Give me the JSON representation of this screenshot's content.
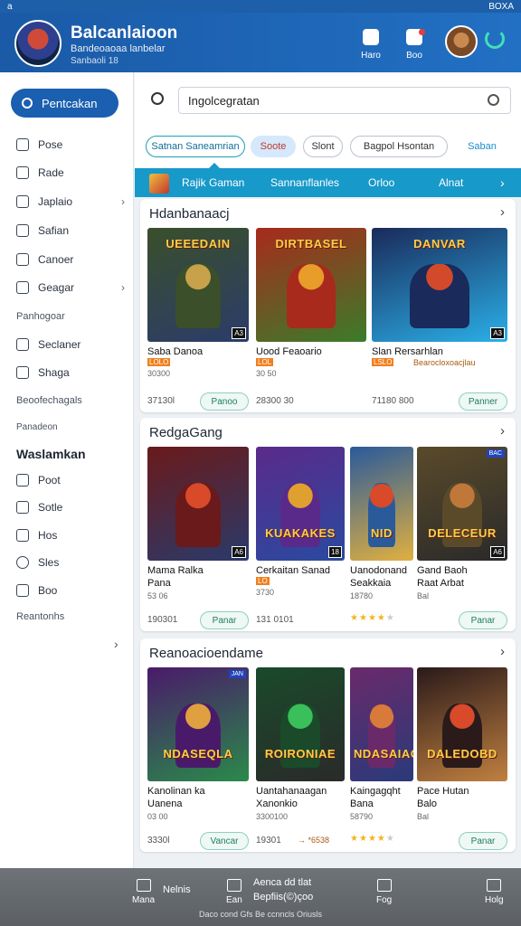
{
  "status": {
    "left": "a",
    "right": "BOXA"
  },
  "header": {
    "title": "Balcanlaioon",
    "subtitle": "Bandeoaoaa lanbelar",
    "subtitle2": "Sanbaoli 18",
    "buttons": [
      {
        "label": "Haro",
        "icon": "home-icon"
      },
      {
        "label": "Boo",
        "icon": "bell-icon"
      }
    ]
  },
  "sidebar": {
    "cta": "Pentcakan",
    "items": [
      {
        "label": "Pose",
        "icon": "pen-icon"
      },
      {
        "label": "Rade",
        "icon": "game-icon"
      },
      {
        "label": "Japlaio",
        "icon": "home-icon",
        "chevron": "›"
      },
      {
        "label": "Safian",
        "icon": "grid-icon"
      },
      {
        "label": "Canoer",
        "icon": "bag-icon"
      },
      {
        "label": "Geagar",
        "icon": "gear-icon",
        "chevron": "›"
      }
    ],
    "text1": "Panhogoar",
    "items2": [
      {
        "label": "Seclaner",
        "icon": "calendar-icon"
      },
      {
        "label": "Shaga",
        "icon": "chart-icon"
      }
    ],
    "text2": "Beoofechagals",
    "text3": "Panadeon",
    "section_title": "Waslamkan",
    "items3": [
      {
        "label": "Poot",
        "icon": "card-icon"
      },
      {
        "label": "Sotle",
        "icon": "list-icon"
      },
      {
        "label": "Hos",
        "icon": "link-icon"
      },
      {
        "label": "Sles",
        "icon": "search-icon"
      },
      {
        "label": "Boo",
        "icon": "box-icon"
      }
    ],
    "text4": "Reantonhs",
    "chevron": "›"
  },
  "search": {
    "value": "Ingolcegratan"
  },
  "chips": [
    "Satnan Saneamrian",
    "Soote",
    "Slont",
    "Bagpol Hsontan",
    "Saban"
  ],
  "tabs": [
    "Rajik Gaman",
    "Sannanflanles",
    "Orloo",
    "Alnat"
  ],
  "sections": [
    {
      "title": "Hdanbanaacj",
      "games": [
        {
          "name": "Saba Danoa",
          "tag": "LOLO",
          "meta": "30300",
          "price": "37130l",
          "buy": "Panoo",
          "logo": "UEEEDAIN",
          "badge": "A3",
          "colors": [
            "#3a4f2a",
            "#c7a24a",
            "#2b3c6a"
          ]
        },
        {
          "name": "Uood Feaoario",
          "tag": "LOL",
          "meta": "30 50",
          "price": "28300 30",
          "logo": "DIRTBASEL",
          "colors": [
            "#a82a1c",
            "#e89c2a",
            "#3a7c2a"
          ]
        },
        {
          "name": "Slan Rersarhlan",
          "tag": "LSLO",
          "meta": "",
          "price": "71180 800",
          "buy": "Panner",
          "alt": "Bearocloxoacjlau",
          "logo": "DANVAR",
          "badge": "A3",
          "colors": [
            "#1a2a5a",
            "#d24a2a",
            "#2ab0e8"
          ]
        }
      ]
    },
    {
      "title": "RedgaGang",
      "games": [
        {
          "name": "Mama Ralka\nPana",
          "meta": "53 06",
          "price": "190301",
          "buy": "Panar",
          "logo": "",
          "badge": "A6",
          "colors": [
            "#6a1a1a",
            "#d84a2a",
            "#2a3a6a"
          ]
        },
        {
          "name": "Cerkaitan Sanad",
          "tag": "LO",
          "meta": "3730",
          "price": "131 0101",
          "logo": "KUAKAKES",
          "badge": "18",
          "colors": [
            "#5a2a8a",
            "#e0a030",
            "#2a4aa0"
          ]
        },
        {
          "name": "Uanodonand\nSeakkaia",
          "meta": "18780",
          "rating": 4,
          "logo": "NID",
          "colors": [
            "#2a5a9a",
            "#d84a2a",
            "#e0b040"
          ]
        },
        {
          "name": "Gand Baoh\nRaat Arbat",
          "meta": "Bal",
          "buy": "Panar",
          "logo": "DELECEUR",
          "badge": "A6",
          "topbadge": "BAC",
          "colors": [
            "#5a4a2a",
            "#c0783a",
            "#2a2a2a"
          ]
        }
      ]
    },
    {
      "title": "Reanoacioendame",
      "games": [
        {
          "name": "Kanolinan ka\nUanena",
          "meta": "03 00",
          "price": "3330l",
          "buy": "Vancar",
          "logo": "NDASEQLA",
          "topbadge": "JAN",
          "colors": [
            "#4a1a6a",
            "#e0a040",
            "#2a8a4a"
          ]
        },
        {
          "name": "Uantahanaagan\nXanonkio",
          "meta": "3300100",
          "price": "19301",
          "alt": "→ *6538",
          "logo": "ROIRONIAE",
          "colors": [
            "#1a4a2a",
            "#3ac05a",
            "#2a2a2a"
          ]
        },
        {
          "name": "Kaingagqht\nBana",
          "meta": "58790",
          "rating": 4,
          "logo": "NDASAIAG",
          "colors": [
            "#6a2a6a",
            "#d87a3a",
            "#2a3a7a"
          ]
        },
        {
          "name": "Pace Hutan\nBalo",
          "meta": "Bal",
          "buy": "Panar",
          "logo": "DALEDOBD",
          "colors": [
            "#2a1a1a",
            "#d84a2a",
            "#c08040"
          ]
        }
      ]
    }
  ],
  "bottomnav": {
    "items": [
      {
        "label": "Mana",
        "icon": "home-icon"
      },
      {
        "label": "Ean",
        "icon": "home-icon"
      },
      {
        "label": "Fog",
        "icon": "doc-icon"
      },
      {
        "label": "Holg",
        "icon": "gamepad-icon"
      }
    ],
    "center1": "Nelnis",
    "center2": "Aenca dd tlat",
    "center3": "Bepfiis(©)çoo",
    "footer": "Daco cond Gfs Be ccnncls Oriusls"
  }
}
